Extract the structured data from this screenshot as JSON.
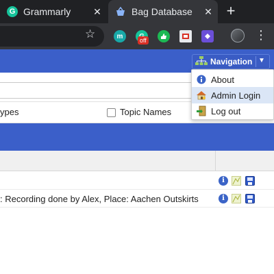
{
  "browser": {
    "tabs": [
      {
        "title": "Grammarly",
        "favicon": "grammarly-icon",
        "active": false
      },
      {
        "title": "Bag Database",
        "favicon": "basket-icon",
        "active": true
      }
    ],
    "new_tab_label": "+",
    "close_glyph": "✕",
    "extensions": [
      {
        "name": "mendeley-icon",
        "glyph": "m",
        "color": "#18a9a8"
      },
      {
        "name": "grammarly-extension-icon",
        "glyph": "G",
        "color": "#15c39a",
        "badge": "off"
      },
      {
        "name": "thumbs-up-icon",
        "glyph": "👍",
        "color": "#1db954"
      },
      {
        "name": "screenshot-icon",
        "glyph": "",
        "color": "#e8eaed"
      },
      {
        "name": "purple-extension-icon",
        "glyph": "",
        "color": "#6b4fd8"
      }
    ]
  },
  "navigation": {
    "button_label": "Navigation",
    "menu": [
      {
        "label": "About",
        "icon": "info-icon"
      },
      {
        "label": "Admin Login",
        "icon": "house-key-icon"
      },
      {
        "label": "Log out",
        "icon": "exit-door-icon"
      }
    ]
  },
  "filters": {
    "types_label": "ypes",
    "topic_names_label": "Topic Names",
    "topic_names_checked": false
  },
  "table": {
    "rows": [
      {
        "text": ""
      },
      {
        "text": ": Recording done by Alex, Place: Aachen Outskirts"
      }
    ]
  },
  "colors": {
    "navbar": "#3b5fc9",
    "chrome_dark": "#202124",
    "chrome_toolbar": "#35363a",
    "menu_hover": "#dbe6f6"
  }
}
